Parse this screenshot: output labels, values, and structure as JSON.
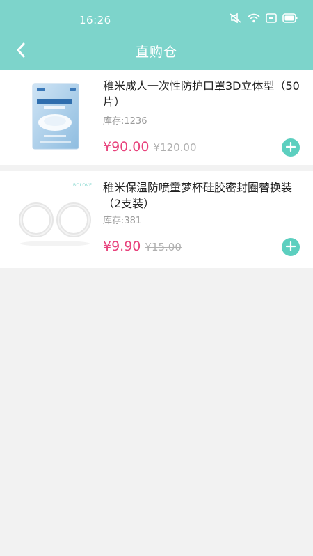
{
  "status_bar": {
    "time": "16:26",
    "icons": [
      "silent-icon",
      "wifi-icon",
      "screen-icon",
      "battery-icon"
    ]
  },
  "nav": {
    "title": "直购仓"
  },
  "colors": {
    "header": "#7dd4cb",
    "price": "#e8427c",
    "add_button": "#5ccfbf"
  },
  "products": [
    {
      "name": "稚米成人一次性防护口罩3D立体型（50片）",
      "stock_label": "库存:",
      "stock": "1236",
      "price": "¥90.00",
      "original_price": "¥120.00"
    },
    {
      "name": "稚米保温防喷童梦杯硅胶密封圈替换装（2支装）",
      "stock_label": "库存:",
      "stock": "381",
      "price": "¥9.90",
      "original_price": "¥15.00",
      "image_brand": "BOLOVE"
    }
  ]
}
